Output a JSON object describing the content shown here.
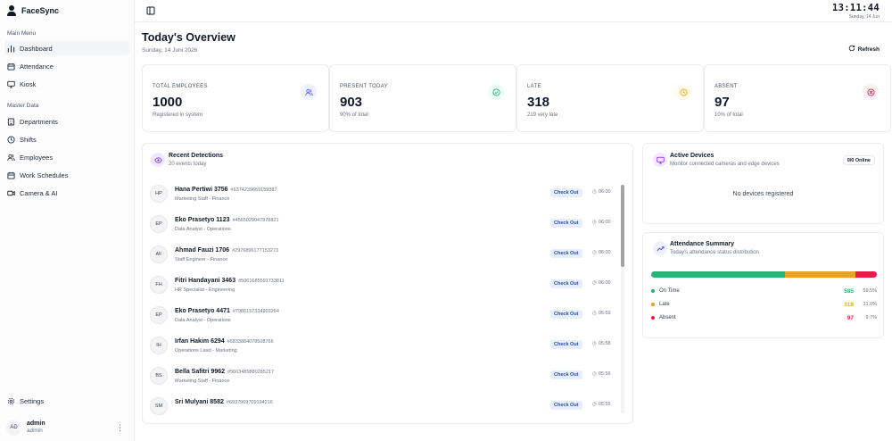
{
  "app": {
    "name": "FaceSync"
  },
  "sidebar": {
    "sections": [
      {
        "label": "Main Menu"
      },
      {
        "label": "Master Data"
      }
    ],
    "main_items": [
      {
        "label": "Dashboard",
        "icon": "bar-chart-icon"
      },
      {
        "label": "Attendance",
        "icon": "calendar-icon"
      },
      {
        "label": "Kiosk",
        "icon": "monitor-icon"
      }
    ],
    "master_items": [
      {
        "label": "Departments",
        "icon": "building-icon"
      },
      {
        "label": "Shifts",
        "icon": "clock-icon"
      },
      {
        "label": "Employees",
        "icon": "users-icon"
      },
      {
        "label": "Work Schedules",
        "icon": "calendar-icon"
      },
      {
        "label": "Camera & AI",
        "icon": "camera-icon"
      }
    ],
    "settings_label": "Settings",
    "user": {
      "initials": "AD",
      "name": "admin",
      "role": "admin"
    }
  },
  "topbar": {
    "time": "13:11:44",
    "date": "Sunday, 14 Jun"
  },
  "page": {
    "title": "Today's Overview",
    "date": "Sunday, 14 Juni 2026",
    "refresh_label": "Refresh"
  },
  "stats": [
    {
      "label": "TOTAL EMPLOYEES",
      "value": "1000",
      "sub": "Registered in system",
      "icon": "users-icon",
      "color": "#6366f1",
      "bg": "#eef2ff"
    },
    {
      "label": "PRESENT TODAY",
      "value": "903",
      "sub": "90% of total",
      "icon": "check-circle-icon",
      "color": "#10b981",
      "bg": "#ecfdf5"
    },
    {
      "label": "LATE",
      "value": "318",
      "sub": "219 very late",
      "icon": "clock-icon",
      "color": "#f59e0b",
      "bg": "#fffbeb"
    },
    {
      "label": "ABSENT",
      "value": "97",
      "sub": "10% of total",
      "icon": "x-circle-icon",
      "color": "#e11d48",
      "bg": "#fff1f2"
    }
  ],
  "detections": {
    "title": "Recent Detections",
    "subtitle": "20 events today",
    "rows": [
      {
        "initials": "HP",
        "name": "Hana Pertiwi 3756",
        "code": "#6374239659159387",
        "role": "Marketing Staff - Finance",
        "status": "Check Out",
        "time": "06:00"
      },
      {
        "initials": "EP",
        "name": "Eko Prasetyo 1123",
        "code": "#4565029047878821",
        "role": "Data Analyst - Operations",
        "status": "Check Out",
        "time": "06:00"
      },
      {
        "initials": "AF",
        "name": "Ahmad Fauzi 1706",
        "code": "#2976896177153273",
        "role": "Staff Engineer - Finance",
        "status": "Check Out",
        "time": "06:00"
      },
      {
        "initials": "FH",
        "name": "Fitri Handayani 3463",
        "code": "#5061685591733811",
        "role": "HR Specialist - Engineering",
        "status": "Check Out",
        "time": "06:00"
      },
      {
        "initials": "EP",
        "name": "Eko Prasetyo 4471",
        "code": "#7986157334903264",
        "role": "Data Analyst - Operations",
        "status": "Check Out",
        "time": "05:59"
      },
      {
        "initials": "IH",
        "name": "Irfan Hakim 6294",
        "code": "#6833884078508766",
        "role": "Operations Lead - Marketing",
        "status": "Check Out",
        "time": "05:58"
      },
      {
        "initials": "BS",
        "name": "Bella Safitri 9962",
        "code": "#5603489880285217",
        "role": "Marketing Staff - Finance",
        "status": "Check Out",
        "time": "05:56"
      },
      {
        "initials": "SM",
        "name": "Sri Mulyani 8582",
        "code": "#6937969709194216",
        "role": "",
        "status": "Check Out",
        "time": "05:55"
      }
    ]
  },
  "devices": {
    "title": "Active Devices",
    "subtitle": "Monitor connected cameras and edge devices",
    "badge": "0/0 Online",
    "empty": "No devices registered"
  },
  "summary": {
    "title": "Attendance Summary",
    "subtitle": "Today's attendance status distribution",
    "items": [
      {
        "label": "On Time",
        "count": "585",
        "pct": "59.5%",
        "fraction": 0.595,
        "color": "#22b573"
      },
      {
        "label": "Late",
        "count": "318",
        "pct": "31.0%",
        "fraction": 0.31,
        "color": "#eaa21d"
      },
      {
        "label": "Absent",
        "count": "97",
        "pct": "9.7%",
        "fraction": 0.097,
        "color": "#e11d48"
      }
    ]
  }
}
